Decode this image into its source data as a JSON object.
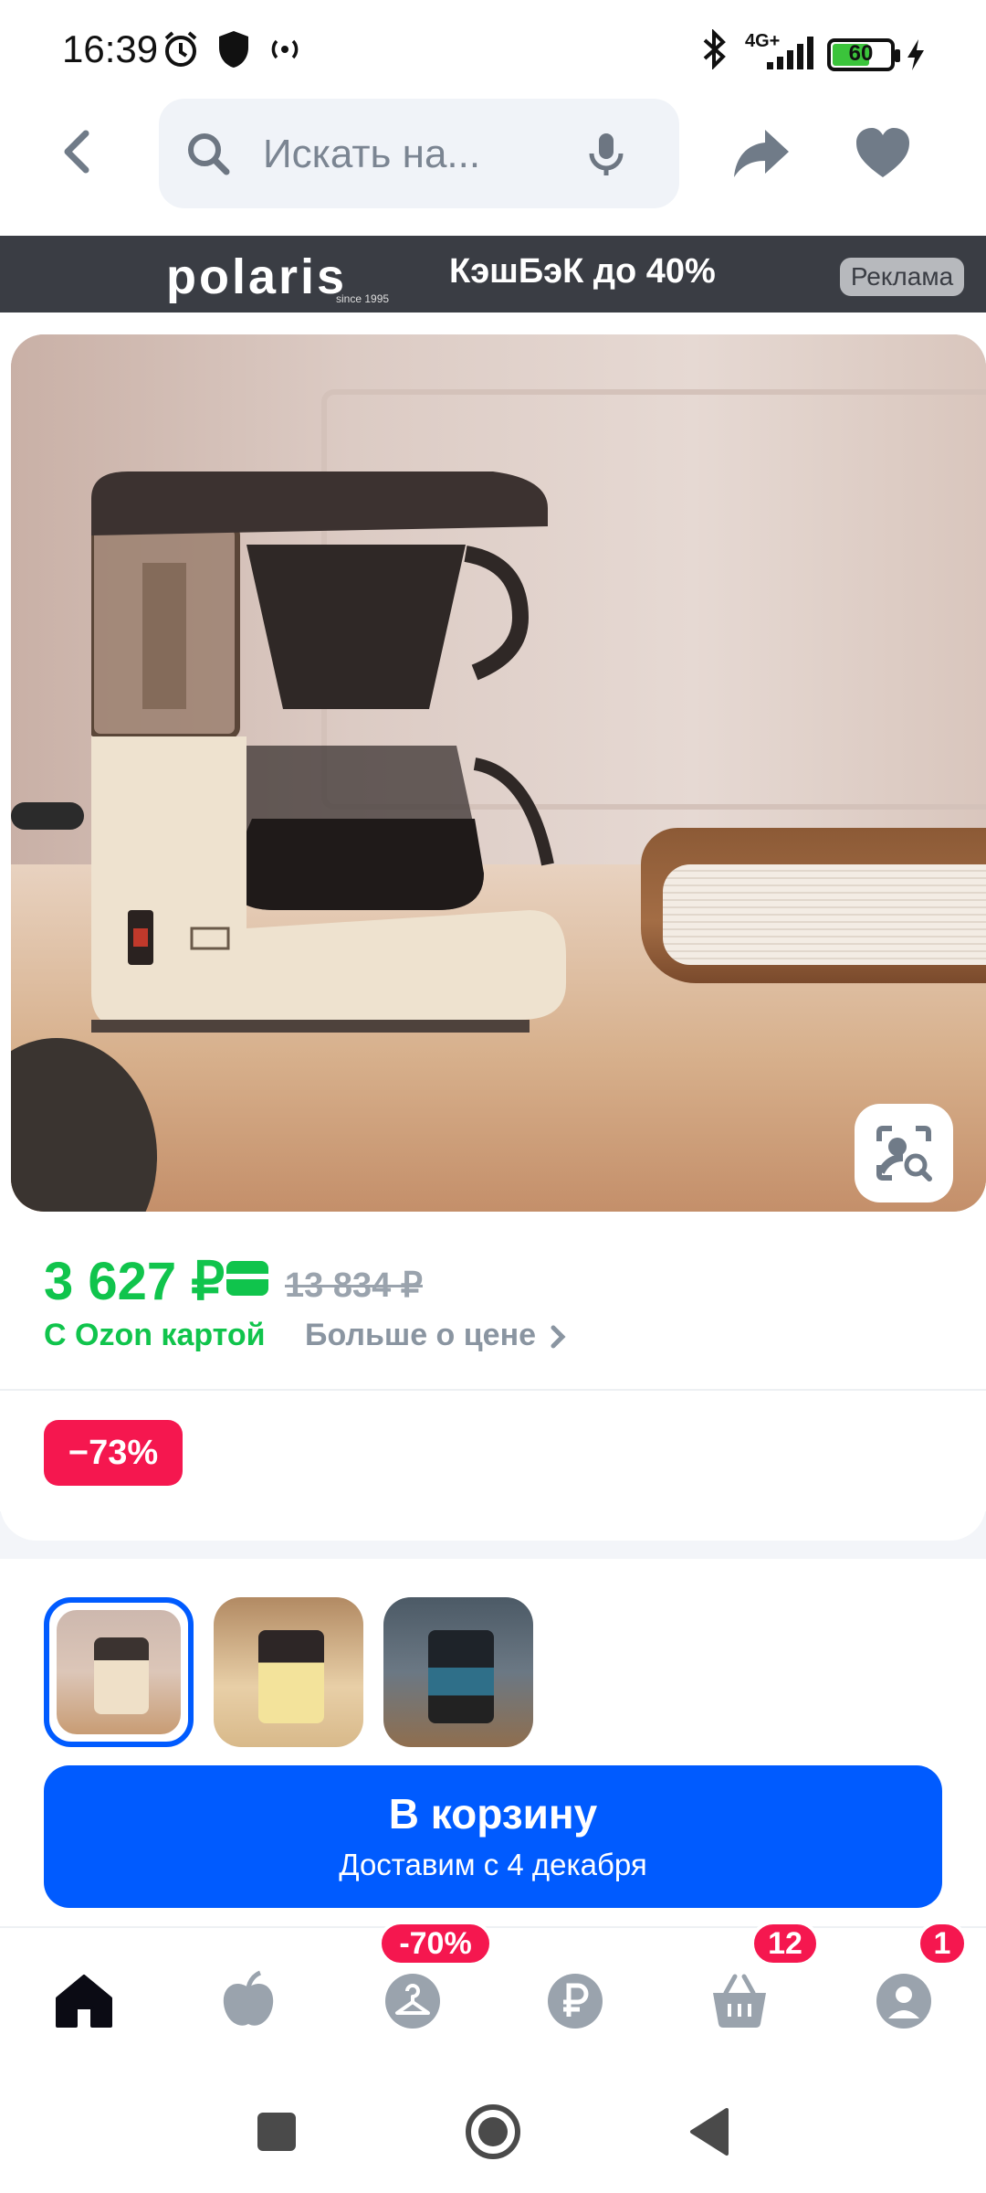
{
  "status_bar": {
    "time": "16:39",
    "network": "4G+",
    "battery_level": "60"
  },
  "search": {
    "placeholder": "Искать на..."
  },
  "ad_banner": {
    "brand": "polaris",
    "brand_since": "since 1995",
    "slogan": "КэшБэК до 40%",
    "ad_label": "Реклама"
  },
  "product": {
    "price": "3 627 ₽",
    "old_price": "13 834 ₽",
    "ozon_card_label": "С Ozon картой",
    "more_about_price": "Больше о цене",
    "discount": "−73%"
  },
  "cart_button": {
    "label": "В корзину",
    "delivery": "Доставим с 4 декабря"
  },
  "bottom_nav": {
    "items": [
      {
        "icon": "home-icon",
        "active": true
      },
      {
        "icon": "fresh-icon"
      },
      {
        "icon": "hanger-icon",
        "badge": "-70%"
      },
      {
        "icon": "ruble-icon"
      },
      {
        "icon": "basket-icon",
        "badge": "12"
      },
      {
        "icon": "profile-icon",
        "badge": "1"
      }
    ]
  },
  "colors": {
    "accent_blue": "#005bff",
    "price_green": "#10c44c",
    "badge_red": "#f5174f"
  }
}
